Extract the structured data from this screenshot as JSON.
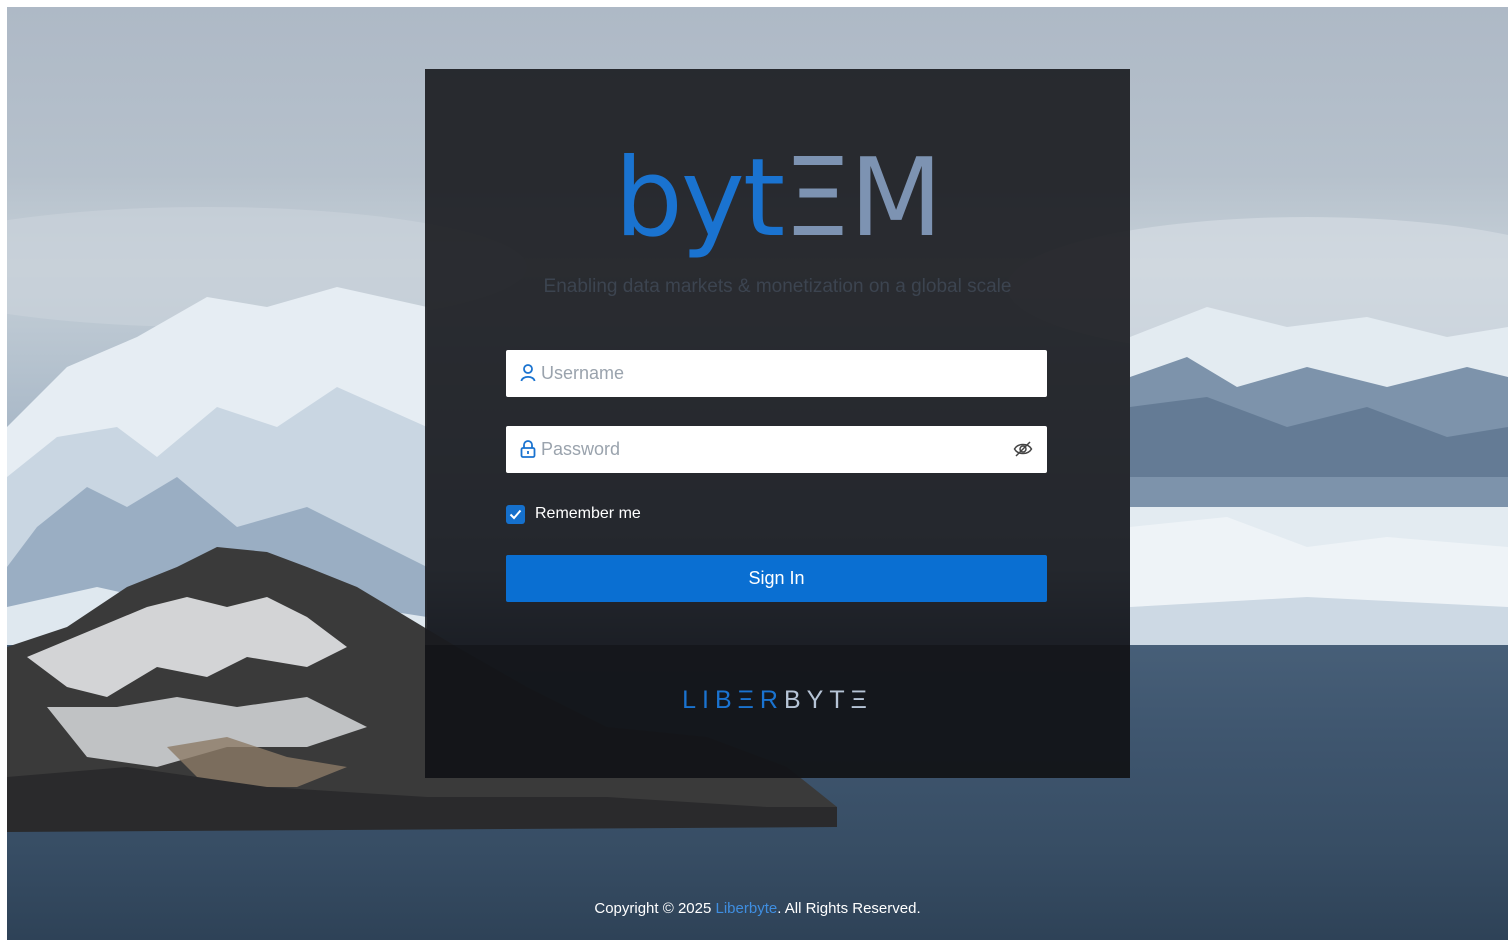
{
  "logo": {
    "part1": "byt",
    "part2": "ΞM"
  },
  "tagline": "Enabling data markets & monetization on a global scale",
  "form": {
    "username_placeholder": "Username",
    "password_placeholder": "Password",
    "remember_label": "Remember me",
    "remember_checked": true,
    "signin_label": "Sign In"
  },
  "brand": {
    "part1": "LIBΞR",
    "part2": "BYTΞ"
  },
  "footer": {
    "prefix": "Copyright © 2025 ",
    "link": "Liberbyte",
    "suffix": ". All Rights Reserved."
  },
  "colors": {
    "accent": "#0a6fd2",
    "logo_blue": "#1a73d0",
    "logo_gray": "#7d93b2",
    "card_bg": "#181a1e"
  },
  "icons": [
    "user-icon",
    "lock-icon",
    "eye-slash-icon",
    "check-icon"
  ]
}
